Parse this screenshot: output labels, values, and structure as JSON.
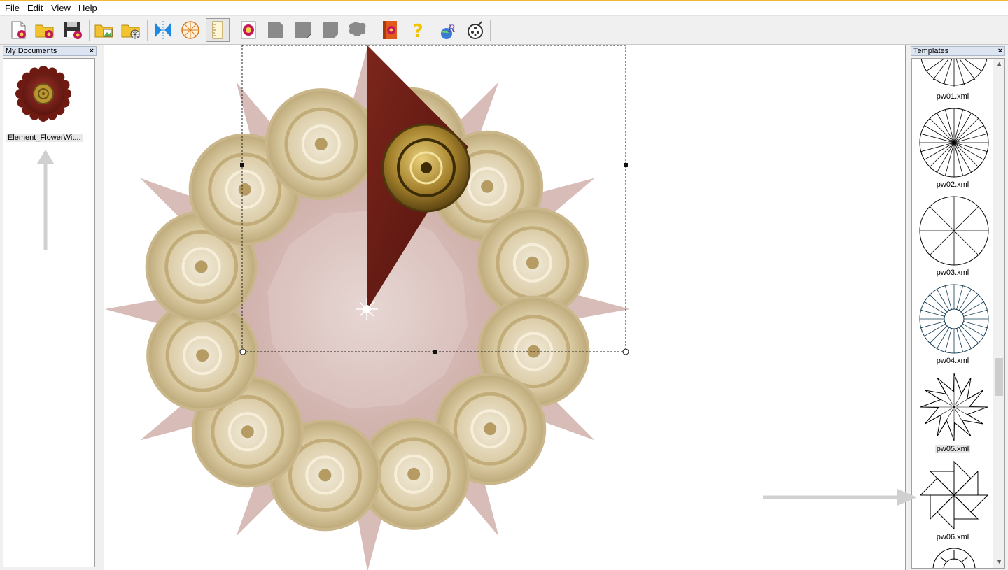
{
  "menu": [
    "File",
    "Edit",
    "View",
    "Help"
  ],
  "toolbar": {
    "buttons": [
      "new-document",
      "open-folder",
      "save",
      "import-image",
      "load-template",
      "mirror",
      "wheel-segments",
      "ruler",
      "flower-edit",
      "segment-1",
      "segment-2",
      "segment-3",
      "shape-blob",
      "help-book",
      "help",
      "web-logo",
      "reel"
    ]
  },
  "left_panel": {
    "title": "My Documents",
    "close": "×",
    "items": [
      {
        "label": "Element_FlowerWit..."
      }
    ]
  },
  "right_panel": {
    "title": "Templates",
    "close": "×",
    "items": [
      {
        "label": "pw01.xml"
      },
      {
        "label": "pw02.xml"
      },
      {
        "label": "pw03.xml"
      },
      {
        "label": "pw04.xml"
      },
      {
        "label": "pw05.xml"
      },
      {
        "label": "pw06.xml"
      }
    ],
    "selected_index": 4
  },
  "colors": {
    "accent_topline": "#f4b73a",
    "petal_dark": "#6e1f17",
    "petal_faded": "#d9c2be",
    "medallion_gold": "#bfa66a"
  }
}
